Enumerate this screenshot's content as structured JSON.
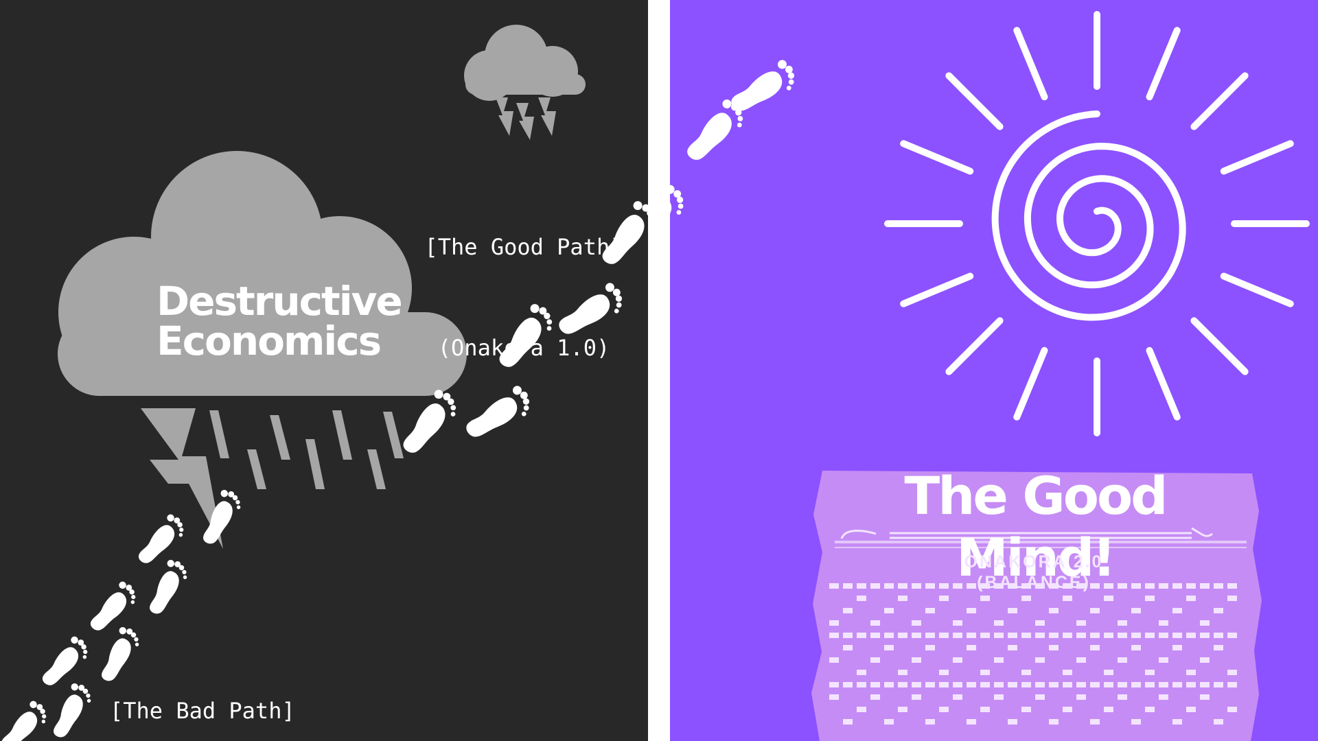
{
  "left": {
    "cloud_text_line1": "Destructive",
    "cloud_text_line2": "Economics",
    "good_path_line1": "[The Good Path]",
    "good_path_line2": "(Onakora 1.0)",
    "bad_path_label": "[The Bad Path]"
  },
  "right": {
    "heading": "The Good Mind!",
    "sub_line1": "ONAKORA 2.0",
    "sub_line2": "(BALANCE)"
  },
  "colors": {
    "left_bg": "#282828",
    "right_bg": "#8c52ff",
    "cloud": "#a6a6a6",
    "white": "#ffffff",
    "belt": "#c58cf5",
    "belt_pattern": "#f3e4ff"
  }
}
